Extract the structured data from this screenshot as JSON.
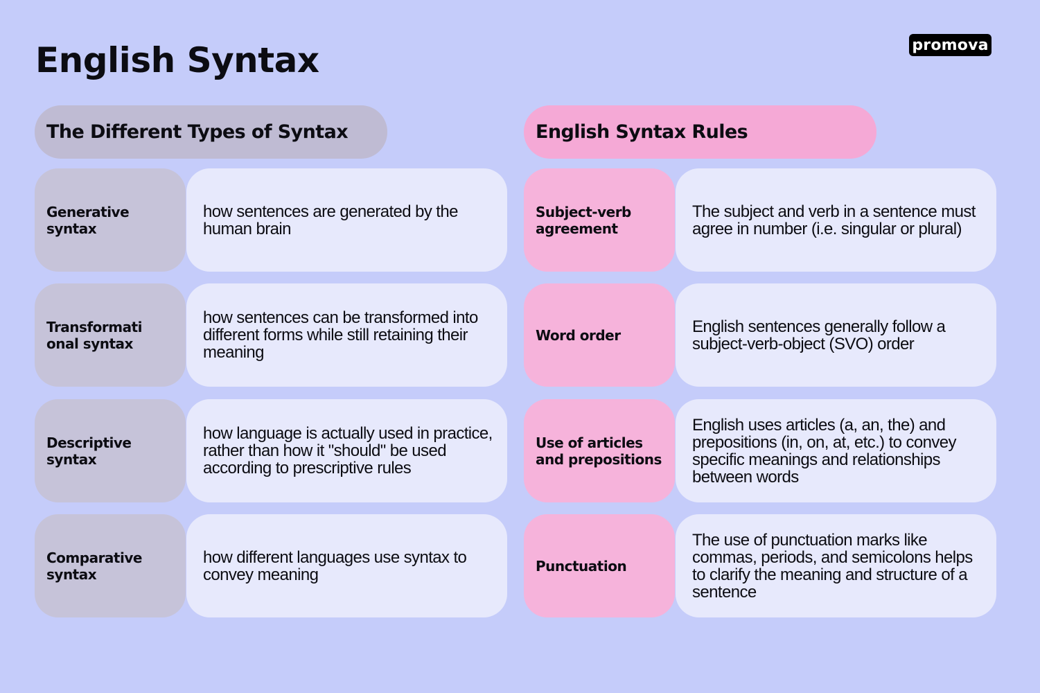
{
  "title": "English Syntax",
  "logo": "promova",
  "colors": {
    "background": "#c5ccfa",
    "left_accent": "#c6c3d9",
    "right_accent": "#f6b3db",
    "description_bg": "#e7e9fc"
  },
  "left_section": {
    "header": "The Different Types of Syntax",
    "rows": [
      {
        "label": "Generative syntax",
        "description": "how sentences are generated by the human brain"
      },
      {
        "label": "Transformational syntax",
        "description": "how sentences can be transformed into different forms while still retaining their meaning"
      },
      {
        "label": "Descriptive syntax",
        "description": "how language is actually used in practice, rather than how it \"should\" be used according to prescriptive rules"
      },
      {
        "label": "Comparative syntax",
        "description": "how different languages use syntax to convey meaning"
      }
    ]
  },
  "right_section": {
    "header": "English Syntax Rules",
    "rows": [
      {
        "label": "Subject-verb agreement",
        "description": "The subject and verb in a sentence must agree in number (i.e. singular or plural)"
      },
      {
        "label": "Word order",
        "description": "English sentences generally follow a subject-verb-object (SVO) order"
      },
      {
        "label": "Use of articles and prepositions",
        "description": "English uses articles (a, an, the) and prepositions (in, on, at, etc.) to convey specific meanings and relationships between words"
      },
      {
        "label": "Punctuation",
        "description": "The use of punctuation marks like commas, periods, and semicolons helps to clarify the meaning and structure of a sentence"
      }
    ]
  }
}
